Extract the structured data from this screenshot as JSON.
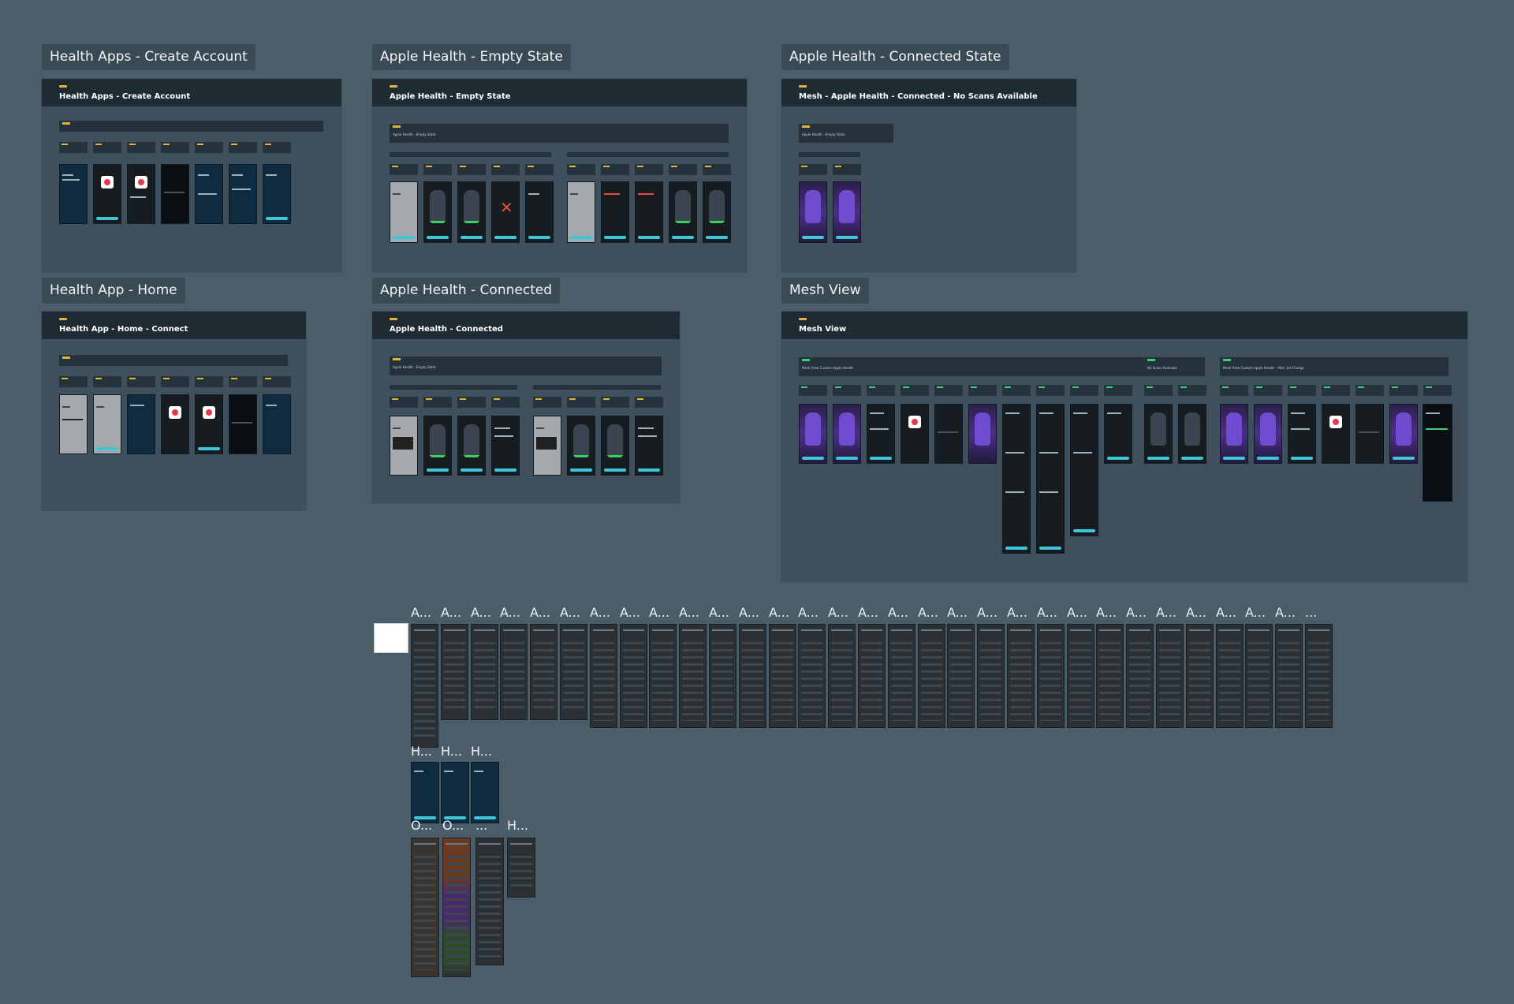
{
  "sections": {
    "create_account": {
      "tag": "Health Apps - Create Account",
      "header": "Health Apps - Create Account"
    },
    "empty_state": {
      "tag": "Apple Health - Empty State",
      "header": "Apple Health - Empty State",
      "sub": "Apple Health - Empty State"
    },
    "connected_state": {
      "tag": "Apple Health - Connected State",
      "header": "Mesh - Apple Health - Connected - No Scans Available",
      "sub": "Apple Health - Empty State"
    },
    "home": {
      "tag": "Health App - Home",
      "header": "Health App - Home - Connect"
    },
    "connected": {
      "tag": "Apple Health - Connected",
      "header": "Apple Health - Connected",
      "sub": "Apple Health - Empty State"
    },
    "mesh_view": {
      "tag": "Mesh View",
      "header": "Mesh View",
      "sub1": "Mesh View Custom Apple Health",
      "sub2": "No Scans Available",
      "sub3": "Mesh View Custom Apple Health - After 1st Change"
    }
  },
  "thumb_rows": {
    "row_a_label": "A...",
    "row_a_last": "...",
    "row_h_label": "H...",
    "row_o_label": "O...",
    "row_o_more": "...",
    "row_o_h": "H..."
  },
  "colors": {
    "canvas": "#4b5d69",
    "frame": "#3f505c",
    "header": "#1e2b33",
    "accent": "#3fc6d8",
    "yellow": "#e0b53a",
    "green": "#3ccf7a"
  }
}
